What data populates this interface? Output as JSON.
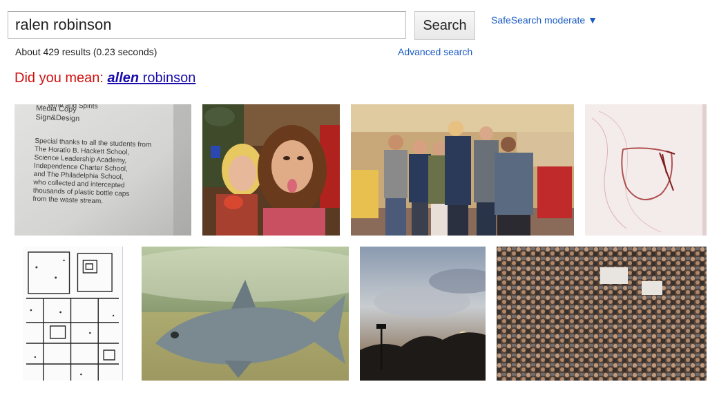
{
  "search": {
    "query": "ralen robinson",
    "button_label": "Search"
  },
  "safesearch": {
    "label": "SafeSearch moderate ▼"
  },
  "results": {
    "stats": "About 429 results (0.23 seconds)",
    "advanced_search": "Advanced search"
  },
  "spelling": {
    "prefix": "Did you mean:",
    "suggestion_bold": "allen",
    "suggestion_rest": " robinson"
  },
  "thumb1_text": {
    "lines": [
      "..... Wine and Spirits",
      "Media Copy",
      "Sign&Design",
      "Special thanks to all the students from",
      "The Horatio B. Hackett School,",
      "Science Leadership Academy,",
      "Independence Charter School,",
      "and The Philadelphia School,",
      "who collected and intercepted",
      "thousands of plastic bottle caps",
      "from the waste stream."
    ]
  },
  "images": [
    {
      "name": "image-result-document"
    },
    {
      "name": "image-result-party-girls"
    },
    {
      "name": "image-result-group-photo"
    },
    {
      "name": "image-result-red-sketch"
    },
    {
      "name": "image-result-map-drawing"
    },
    {
      "name": "image-result-fish"
    },
    {
      "name": "image-result-sunset"
    },
    {
      "name": "image-result-crowd"
    }
  ]
}
